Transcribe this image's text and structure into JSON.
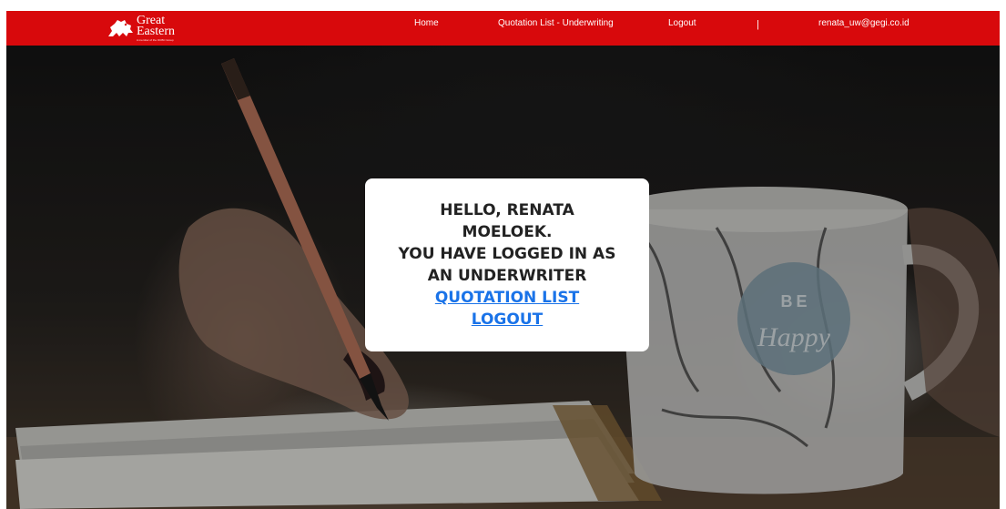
{
  "brand": {
    "name_line1": "Great",
    "name_line2": "Eastern",
    "tagline": "A member of the OCBC Group",
    "color": "#d8090c"
  },
  "nav": {
    "home_label": "Home",
    "quotation_label": "Quotation List - Underwriting",
    "logout_label": "Logout",
    "separator": "|",
    "user_email": "renata_uw@gegi.co.id"
  },
  "card": {
    "greeting_line1": "HELLO, RENATA MOELOEK.",
    "greeting_line2": "YOU HAVE LOGGED IN AS AN UNDERWRITER",
    "quotation_link": "QUOTATION LIST",
    "logout_link": "LOGOUT",
    "link_color": "#1a73e8"
  },
  "hero": {
    "mug_text_line1": "BE",
    "mug_text_line2": "Happy"
  }
}
